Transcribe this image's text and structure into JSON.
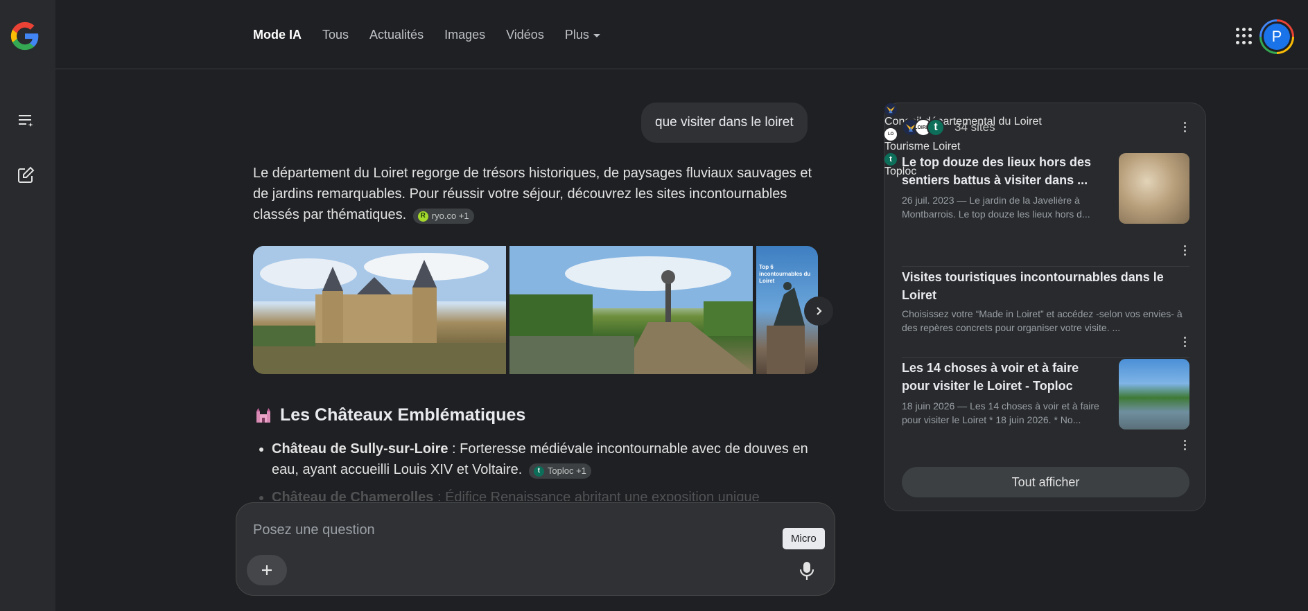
{
  "tabs": [
    {
      "label": "Mode IA",
      "active": true
    },
    {
      "label": "Tous"
    },
    {
      "label": "Actualités"
    },
    {
      "label": "Images"
    },
    {
      "label": "Vidéos"
    },
    {
      "label": "Plus",
      "dropdown": true
    }
  ],
  "user": {
    "avatar_letter": "P"
  },
  "query": "que visiter dans le loiret",
  "answer": {
    "intro": "Le département du Loiret regorge de trésors historiques, de paysages fluviaux sauvages et de jardins remarquables. Pour réussir votre séjour, découvrez les sites incontournables classés par thématiques.",
    "intro_chip": {
      "label": "ryo.co +1",
      "icon_letter": "R"
    },
    "section_title": "Les Châteaux Emblématiques",
    "bullets": [
      {
        "bold": "Château de Sully-sur-Loire",
        "text": " : Forteresse médiévale incontournable avec de douves en eau, ayant accueilli Louis XIV et Voltaire.",
        "chip": {
          "label": "Toploc +1",
          "icon_letter": "t"
        }
      },
      {
        "bold": "Château de Chamerolles",
        "text": " : Édifice Renaissance abritant une exposition unique"
      }
    ]
  },
  "gallery": {
    "images": [
      "chateau-sully-sur-loire",
      "pont-canal-briare",
      "statue-jeanne-arc"
    ],
    "third_caption": "Top 6 incontournables du Loiret"
  },
  "input": {
    "placeholder": "Posez une question",
    "mic_tooltip": "Micro"
  },
  "sources": {
    "count_label": "34 sites",
    "cards": [
      {
        "title": "Le top douze des lieux hors des sentiers battus à visiter dans ...",
        "snippet": "26 juil. 2023 — Le jardin de la Javelière à Montbarrois. Le top douze les lieux hors d...",
        "source": "Conseil départemental du Loiret"
      },
      {
        "title": "Visites touristiques incontournables dans le Loiret",
        "snippet": "Choisissez votre “Made in Loiret” et accédez -selon vos envies- à des repères concrets pour organiser votre visite. ...",
        "source": "Tourisme Loiret"
      },
      {
        "title": "Les 14 choses à voir et à faire pour visiter le Loiret - Toploc",
        "snippet": "18 juin 2026 — Les 14 choses à voir et à faire pour visiter le Loiret * 18 juin 2026. * No...",
        "source": "Toploc"
      }
    ],
    "show_all": "Tout afficher"
  },
  "colors": {
    "background": "#1f2023",
    "rail": "#282a2d",
    "accent_blue": "#1a73e8"
  }
}
